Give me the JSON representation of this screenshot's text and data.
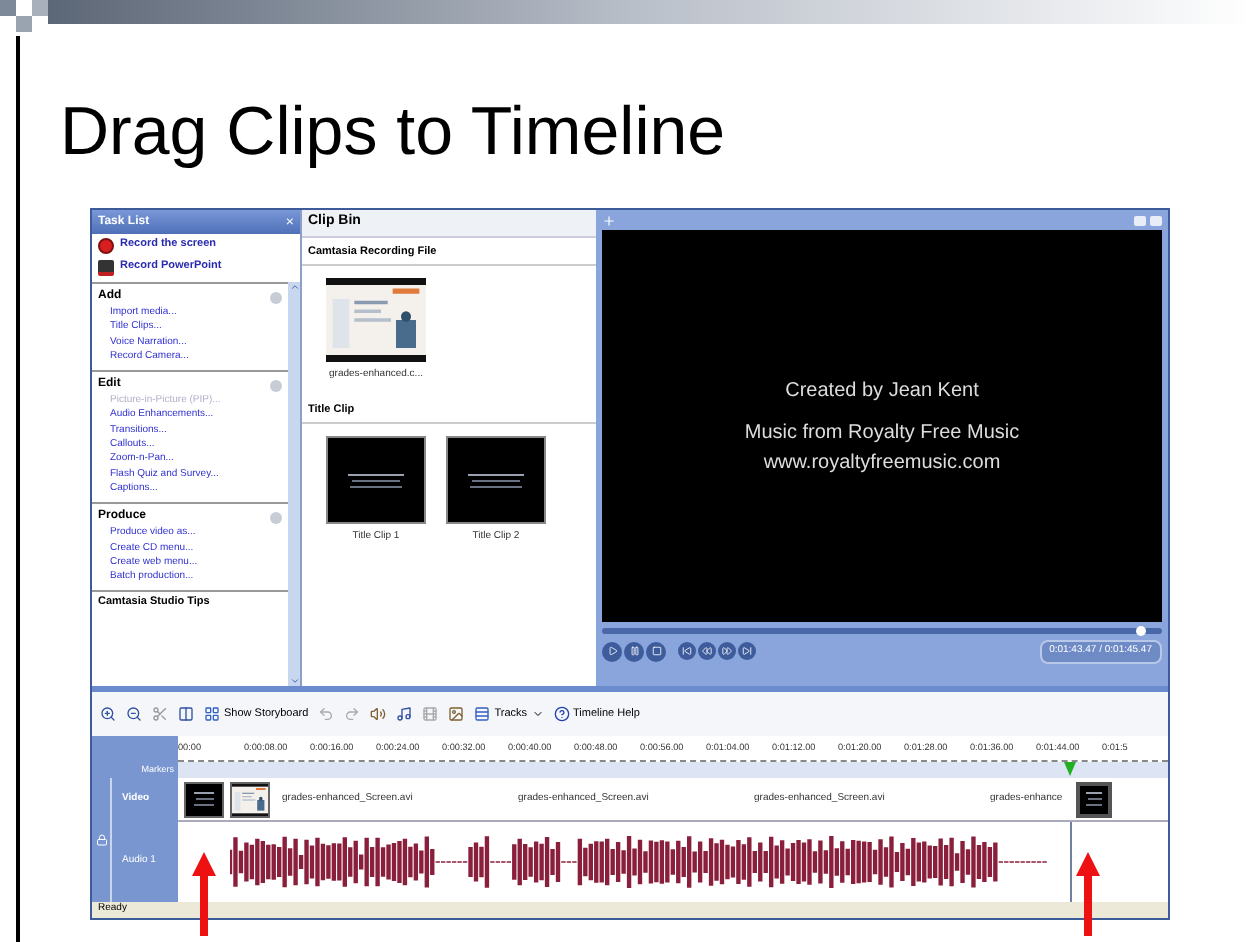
{
  "slide": {
    "title": "Drag Clips to Timeline"
  },
  "task_list": {
    "title": "Task List",
    "close": "×",
    "actions": [
      {
        "label": "Record the screen",
        "kind": "record"
      },
      {
        "label": "Record PowerPoint",
        "kind": "powerpoint"
      }
    ],
    "sections": [
      {
        "title": "Add",
        "items": [
          {
            "label": "Import media...",
            "disabled": false
          },
          {
            "label": "Title Clips...",
            "disabled": false
          },
          {
            "label": "Voice Narration...",
            "disabled": false
          },
          {
            "label": "Record Camera...",
            "disabled": false
          }
        ]
      },
      {
        "title": "Edit",
        "items": [
          {
            "label": "Picture-in-Picture (PIP)...",
            "disabled": true
          },
          {
            "label": "Audio Enhancements...",
            "disabled": false
          },
          {
            "label": "Transitions...",
            "disabled": false
          },
          {
            "label": "Callouts...",
            "disabled": false
          },
          {
            "label": "Zoom-n-Pan...",
            "disabled": false
          },
          {
            "label": "Flash Quiz and Survey...",
            "disabled": false
          },
          {
            "label": "Captions...",
            "disabled": false
          }
        ]
      },
      {
        "title": "Produce",
        "items": [
          {
            "label": "Produce video as...",
            "disabled": false
          },
          {
            "label": "Create CD menu...",
            "disabled": false
          },
          {
            "label": "Create web menu...",
            "disabled": false
          },
          {
            "label": "Batch production...",
            "disabled": false
          }
        ]
      }
    ],
    "tips_title": "Camtasia Studio Tips"
  },
  "clip_bin": {
    "title": "Clip Bin",
    "groups": [
      {
        "title": "Camtasia Recording File",
        "kind": "recording",
        "clips": [
          {
            "label": "grades-enhanced.c..."
          }
        ]
      },
      {
        "title": "Title Clip",
        "kind": "title",
        "clips": [
          {
            "label": "Title Clip 1"
          },
          {
            "label": "Title Clip 2"
          }
        ]
      }
    ]
  },
  "preview": {
    "lines": [
      "Created by Jean Kent",
      "Music from Royalty Free Music",
      "www.royaltyfreemusic.com"
    ],
    "level": 0.96,
    "time": "0:01:43.47 / 0:01:45.47"
  },
  "toolbar": {
    "storyboard": "Show Storyboard",
    "tracks": "Tracks",
    "help": "Timeline Help"
  },
  "timeline": {
    "ruler": [
      "00:00",
      "0:00:08.00",
      "0:00:16.00",
      "0:00:24.00",
      "0:00:32.00",
      "0:00:40.00",
      "0:00:48.00",
      "0:00:56.00",
      "0:01:04.00",
      "0:01:12.00",
      "0:01:20.00",
      "0:01:28.00",
      "0:01:36.00",
      "0:01:44.00",
      "0:01:5"
    ],
    "playhead": {
      "level": 0.9
    },
    "tracks": [
      "Markers",
      "Video",
      "Audio 1"
    ],
    "video_clips": [
      "grades-enhanced_Screen.avi",
      "grades-enhanced_Screen.avi",
      "grades-enhanced_Screen.avi",
      "grades-enhance"
    ]
  },
  "status_bar": "Ready"
}
